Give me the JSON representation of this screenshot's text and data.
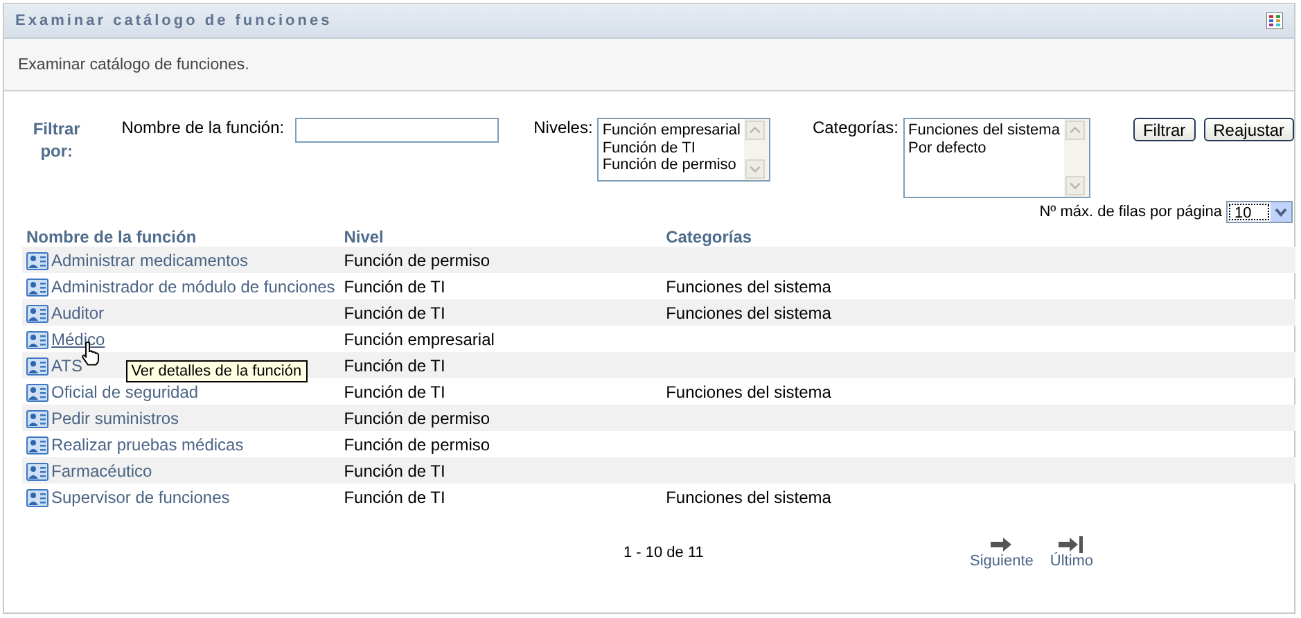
{
  "window": {
    "title": "Examinar catálogo de funciones"
  },
  "description": "Examinar catálogo de funciones.",
  "filter": {
    "heading": "Filtrar por:",
    "name_label": "Nombre de la función:",
    "levels_label": "Niveles:",
    "levels": [
      "Función empresarial",
      "Función de TI",
      "Función de permiso"
    ],
    "categories_label": "Categorías:",
    "categories": [
      "Funciones del sistema",
      "Por defecto"
    ],
    "buttons": [
      "Filtrar",
      "Reajustar"
    ]
  },
  "page_size": {
    "label": "Nº máx. de filas por página",
    "value": "10"
  },
  "table": {
    "columns": [
      "Nombre de la función",
      "Nivel",
      "Categorías"
    ],
    "rows": [
      {
        "name": "Administrar medicamentos",
        "level": "Función de permiso",
        "hovered": false
      },
      {
        "name": "Administrador de módulo de funciones",
        "level": "Función de TI",
        "category": "Funciones del sistema",
        "hovered": false
      },
      {
        "name": "Auditor",
        "level": "Función de TI",
        "category": "Funciones del sistema",
        "hovered": false
      },
      {
        "name": "Médico",
        "level": "Función empresarial",
        "hovered": true
      },
      {
        "name": "ATS",
        "level": "Función de TI",
        "hovered": false
      },
      {
        "name": "Oficial de seguridad",
        "level": "Función de TI",
        "category": "Funciones del sistema",
        "hovered": false
      },
      {
        "name": "Pedir suministros",
        "level": "Función de permiso",
        "hovered": false
      },
      {
        "name": "Realizar pruebas médicas",
        "level": "Función de permiso",
        "hovered": false
      },
      {
        "name": "Farmacéutico",
        "level": "Función de TI",
        "hovered": false
      },
      {
        "name": "Supervisor de funciones",
        "level": "Función de TI",
        "category": "Funciones del sistema",
        "hovered": false
      }
    ]
  },
  "tooltip": "Ver detalles de la función",
  "pagination": {
    "range": "1 - 10 de 11",
    "links": [
      {
        "label": "Siguiente",
        "kind": "next"
      },
      {
        "label": "Último",
        "kind": "last"
      }
    ]
  }
}
